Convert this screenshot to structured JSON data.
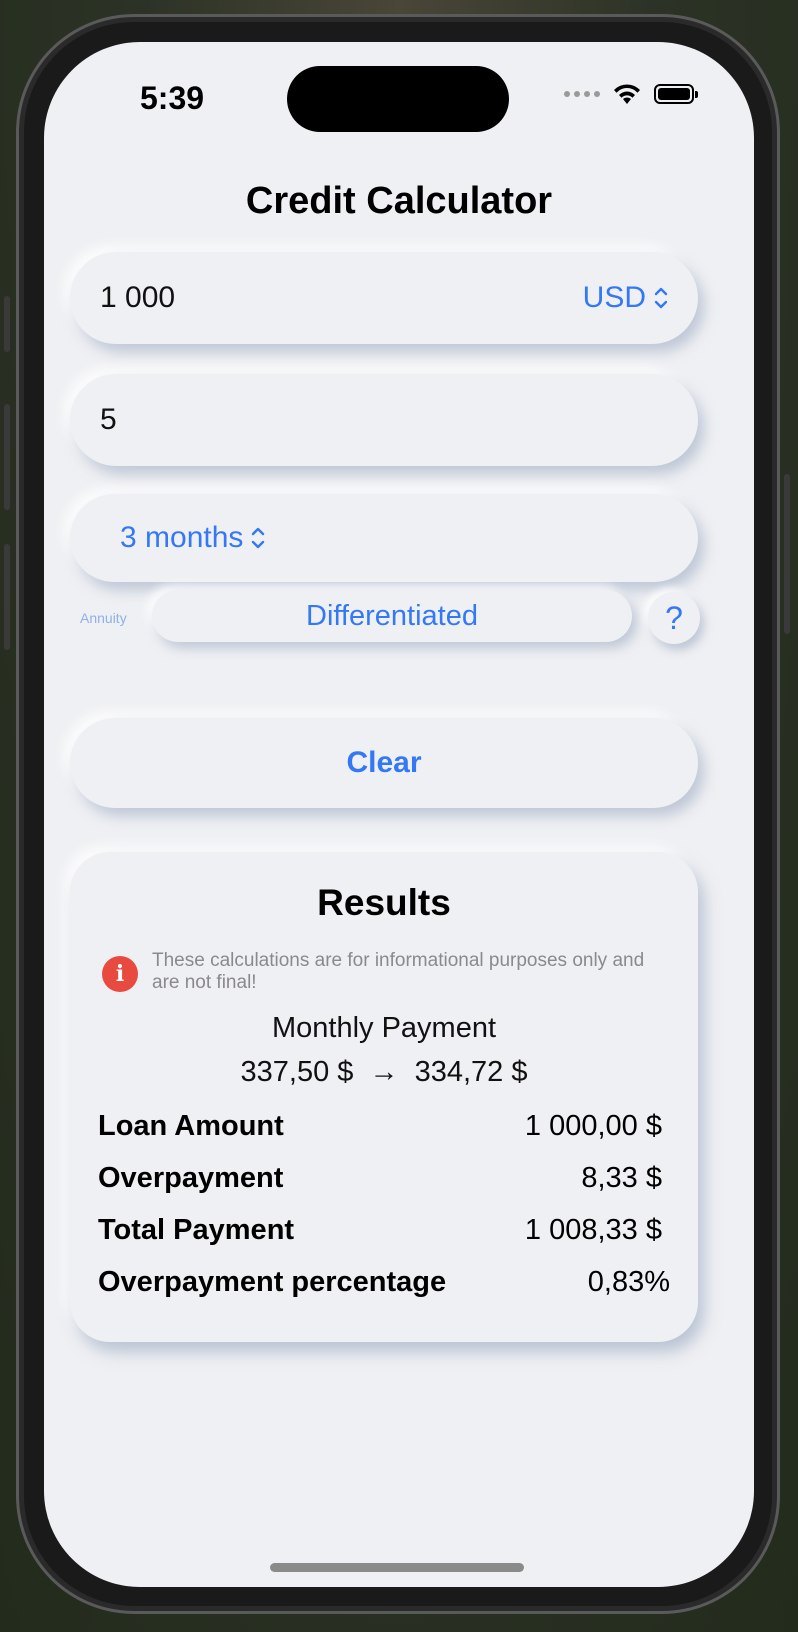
{
  "status_bar": {
    "time": "5:39"
  },
  "app": {
    "title": "Credit Calculator"
  },
  "amount": {
    "value": "1 000",
    "currency": "USD"
  },
  "rate": {
    "value": "5"
  },
  "term": {
    "value": "3 months"
  },
  "payment_type": {
    "left_label": "Annuity",
    "selected": "Differentiated",
    "help": "?"
  },
  "clear_label": "Clear",
  "results": {
    "title": "Results",
    "notice": "These calculations are for informational purposes only and are not final!",
    "monthly_label": "Monthly Payment",
    "monthly_first": "337,50 $",
    "arrow": "→",
    "monthly_last": "334,72 $",
    "rows": [
      {
        "label": "Loan Amount",
        "value": "1 000,00 $"
      },
      {
        "label": "Overpayment",
        "value": "8,33 $"
      },
      {
        "label": "Total Payment",
        "value": "1 008,33 $"
      },
      {
        "label": "Overpayment percentage",
        "value": "0,83%"
      }
    ]
  },
  "colors": {
    "accent": "#3478f6",
    "background": "#eff0f3",
    "warning": "#e84a3f"
  }
}
